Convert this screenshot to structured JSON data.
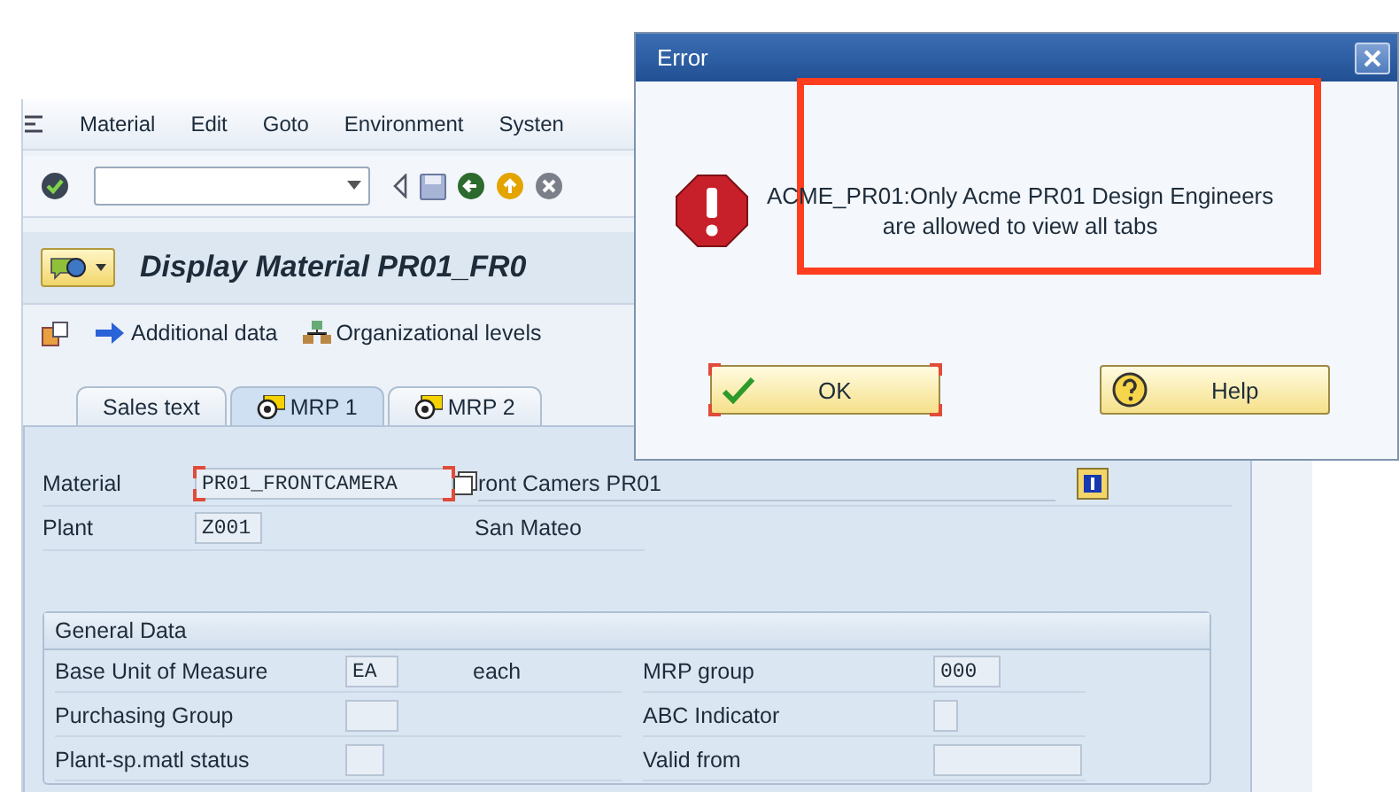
{
  "menu": [
    {
      "label": "Material"
    },
    {
      "label": "Edit"
    },
    {
      "label": "Goto"
    },
    {
      "label": "Environment"
    },
    {
      "label": "Systen"
    }
  ],
  "title": "Display Material PR01_FR0",
  "app_toolbar": [
    {
      "label": "Additional data",
      "kind": "arrow"
    },
    {
      "label": "Organizational levels",
      "kind": "org"
    }
  ],
  "tabs": [
    {
      "label": "Sales text",
      "selected": false,
      "kind": "plain"
    },
    {
      "label": "MRP 1",
      "selected": true,
      "kind": "target"
    },
    {
      "label": "MRP 2",
      "selected": false,
      "kind": "target"
    }
  ],
  "header": {
    "material_label": "Material",
    "material_value": "PR01_FRONTCAMERA",
    "material_focused": true,
    "description": "ront Camers PR01",
    "plant_label": "Plant",
    "plant_value": "Z001",
    "plant_name": "San Mateo"
  },
  "general_data": {
    "title": "General Data",
    "rows": [
      {
        "left_label": "Base Unit of Measure",
        "left_value": "EA",
        "left_text": "each",
        "right_label": "MRP group",
        "right_value": "000"
      },
      {
        "left_label": "Purchasing Group",
        "left_value": "",
        "right_label": "ABC Indicator",
        "right_value": ""
      },
      {
        "left_label": "Plant-sp.matl status",
        "left_value": "",
        "right_label": "Valid from",
        "right_value": ""
      }
    ]
  },
  "dialog": {
    "title": "Error",
    "message": "ACME_PR01:Only Acme PR01 Design Engineers\nare allowed to view all tabs",
    "buttons": [
      {
        "label": "OK",
        "kind": "ok",
        "focused": true
      },
      {
        "label": "Help",
        "kind": "help",
        "focused": false
      }
    ]
  }
}
